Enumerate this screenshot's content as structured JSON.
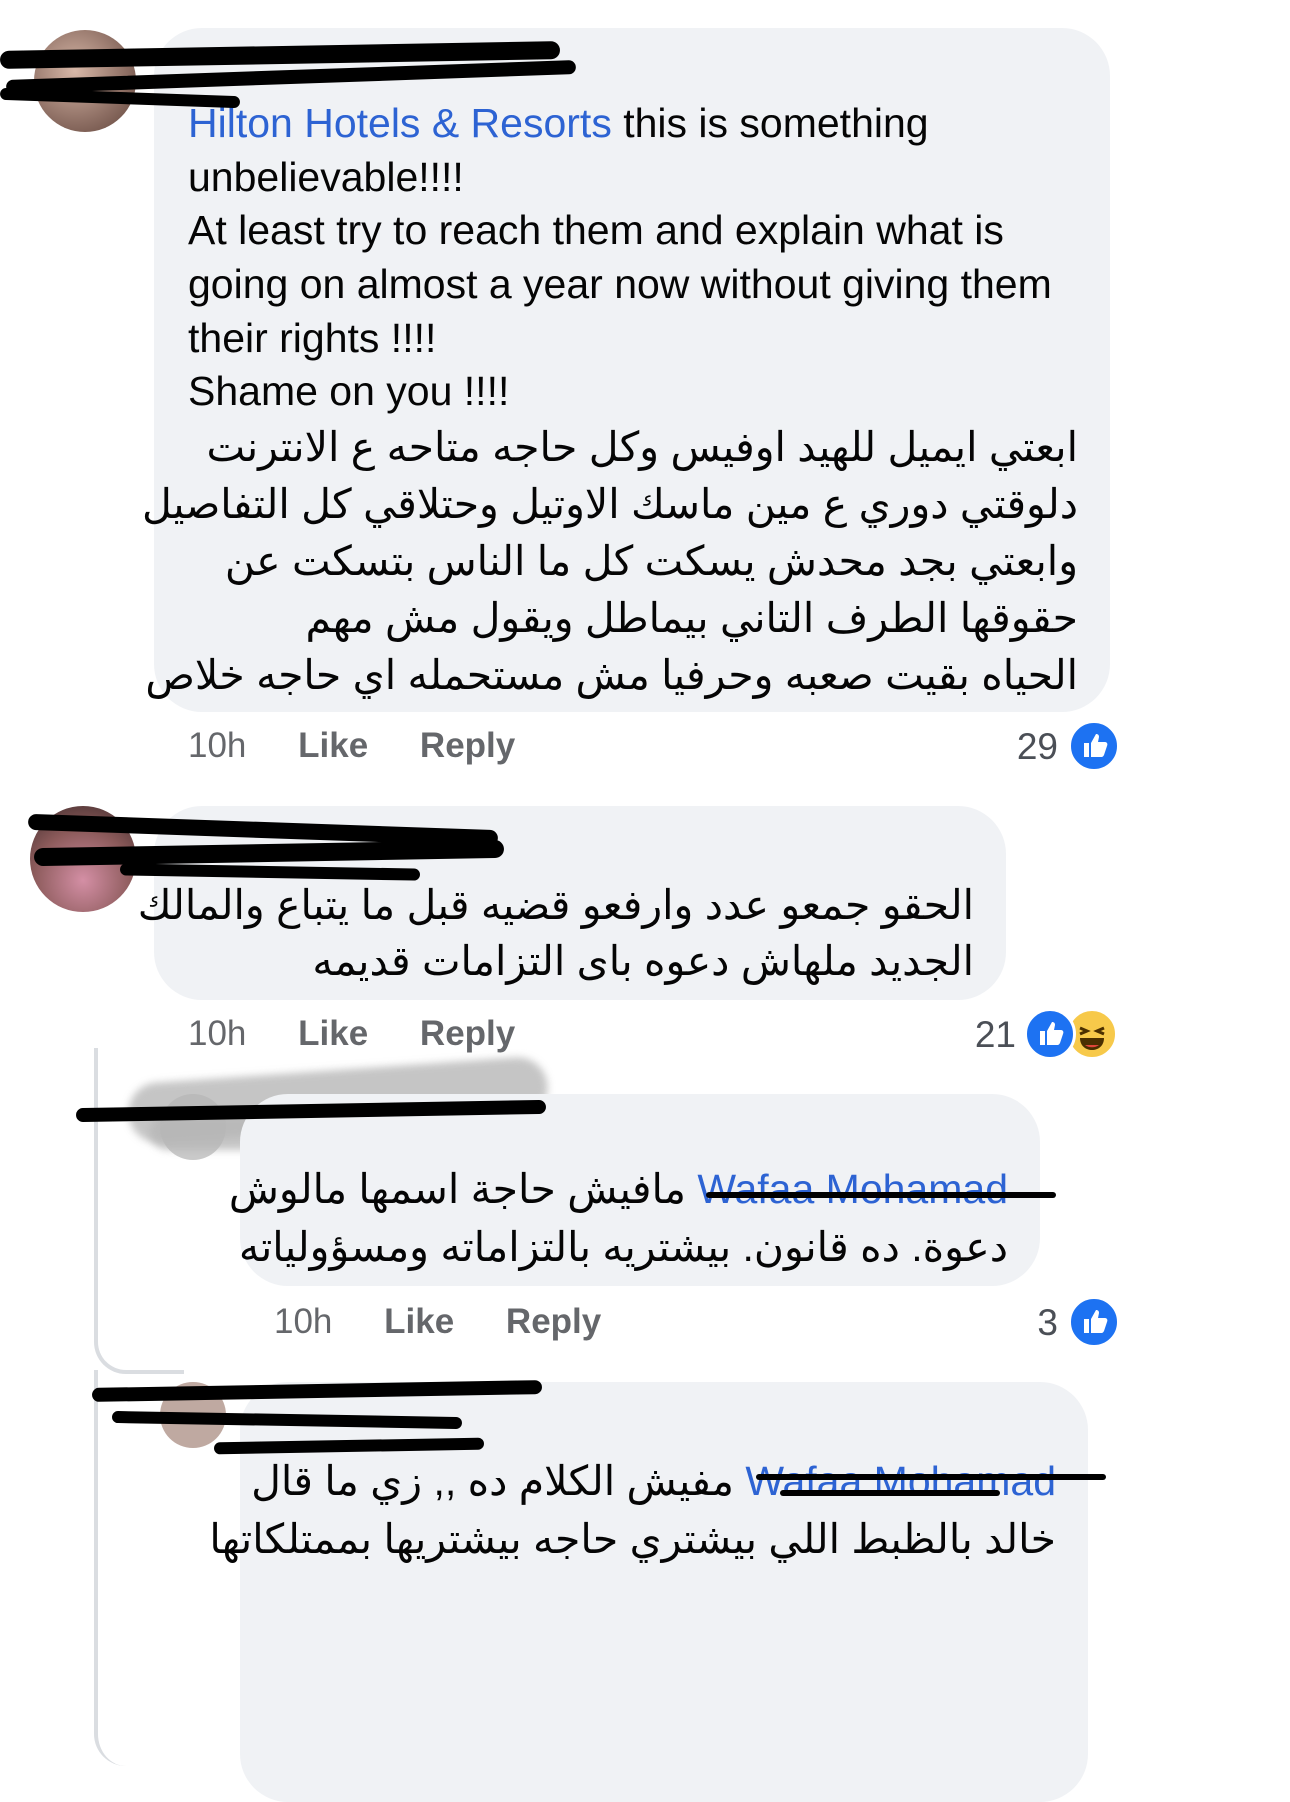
{
  "colors": {
    "bubble": "#f0f2f5",
    "link": "#2d63d3",
    "meta": "#65676b",
    "like_blue": "#1d72f2",
    "haha_yellow": "#f7c94a"
  },
  "comments": [
    {
      "mention": "Hilton Hotels & Resorts",
      "text_lines": [
        "this is something",
        "unbelievable!!!!",
        "At least try to reach them and explain what is",
        "going on almost a year now  without  giving them",
        "their rights  !!!!",
        "Shame on you !!!!",
        "ابعتي ايميل  للهيد اوفيس وكل حاجه متاحه ع الانترنت",
        "دلوقتي دوري ع مين ماسك الاوتيل وحتلاقي كل التفاصيل",
        "وابعتي بجد محدش يسكت كل ما الناس بتسكت عن",
        "حقوقها الطرف التاني بيماطل ويقول مش مهم",
        "الحياه بقيت صعبه وحرفيا مش مستحمله اي حاجه خلاص"
      ],
      "time": "10h",
      "like": "Like",
      "reply": "Reply",
      "reaction_count": "29",
      "reactions": [
        "like-icon"
      ]
    },
    {
      "text_lines": [
        "الحقو جمعو عدد وارفعو قضيه قبل ما يتباع والمالك",
        "الجديد ملهاش دعوه باى التزامات قديمه"
      ],
      "time": "10h",
      "like": "Like",
      "reply": "Reply",
      "reaction_count": "21",
      "reactions": [
        "like-icon",
        "haha-icon"
      ]
    },
    {
      "mention": "Wafaa Mohamad",
      "text_lines": [
        "مافيش حاجة اسمها مالوش",
        "دعوة. ده قانون. بيشتريه بالتزاماته ومسؤولياته"
      ],
      "time": "10h",
      "like": "Like",
      "reply": "Reply",
      "reaction_count": "3",
      "reactions": [
        "like-icon"
      ]
    },
    {
      "mention": "Wafaa Mohamad",
      "text_lines": [
        "مفيش الكلام ده ,, زي ما قال",
        "خالد بالظبط اللي بيشتري حاجه بيشتريها بممتلكاتها"
      ]
    }
  ]
}
